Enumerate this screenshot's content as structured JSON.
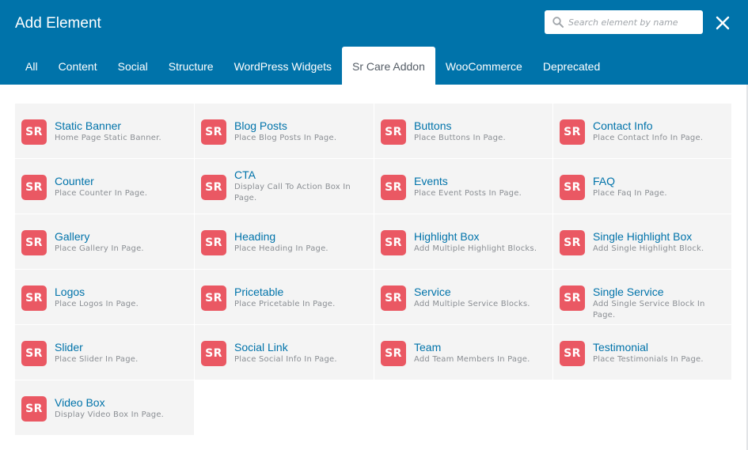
{
  "header": {
    "title": "Add Element",
    "search_placeholder": "Search element by name",
    "search_value": ""
  },
  "tabs": [
    {
      "label": "All"
    },
    {
      "label": "Content"
    },
    {
      "label": "Social"
    },
    {
      "label": "Structure"
    },
    {
      "label": "WordPress Widgets"
    },
    {
      "label": "Sr Care Addon",
      "active": true
    },
    {
      "label": "WooCommerce"
    },
    {
      "label": "Deprecated"
    }
  ],
  "badge_text": "SR",
  "colors": {
    "header_bg": "#0073aa",
    "badge_bg": "#ea5863",
    "name_text": "#0073aa",
    "cell_bg": "#f4f4f4"
  },
  "elements": [
    {
      "name": "Static Banner",
      "desc": "Home Page Static Banner."
    },
    {
      "name": "Blog Posts",
      "desc": "Place Blog Posts In Page."
    },
    {
      "name": "Buttons",
      "desc": "Place Buttons In Page."
    },
    {
      "name": "Contact Info",
      "desc": "Place Contact Info In Page."
    },
    {
      "name": "Counter",
      "desc": "Place Counter In Page."
    },
    {
      "name": "CTA",
      "desc": "Display Call To Action Box In Page."
    },
    {
      "name": "Events",
      "desc": "Place Event Posts In Page."
    },
    {
      "name": "FAQ",
      "desc": "Place Faq In Page."
    },
    {
      "name": "Gallery",
      "desc": "Place Gallery In Page."
    },
    {
      "name": "Heading",
      "desc": "Place Heading In Page."
    },
    {
      "name": "Highlight Box",
      "desc": "Add Multiple Highlight Blocks."
    },
    {
      "name": "Single Highlight Box",
      "desc": "Add Single Highlight Block."
    },
    {
      "name": "Logos",
      "desc": "Place Logos In Page."
    },
    {
      "name": "Pricetable",
      "desc": "Place Pricetable In Page."
    },
    {
      "name": "Service",
      "desc": "Add Multiple Service Blocks."
    },
    {
      "name": "Single Service",
      "desc": "Add Single Service Block In Page."
    },
    {
      "name": "Slider",
      "desc": "Place Slider In Page."
    },
    {
      "name": "Social Link",
      "desc": "Place Social Info In Page."
    },
    {
      "name": "Team",
      "desc": "Add Team Members In Page."
    },
    {
      "name": "Testimonial",
      "desc": "Place Testimonials In Page."
    },
    {
      "name": "Video Box",
      "desc": "Display Video Box In Page."
    }
  ]
}
